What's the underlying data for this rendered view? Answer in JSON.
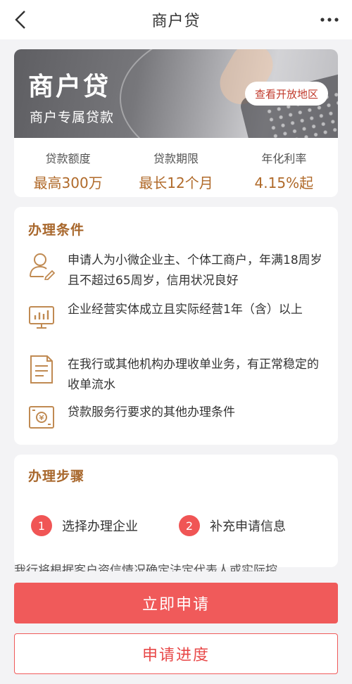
{
  "navbar": {
    "title": "商户贷",
    "back_icon": "chevron-left-icon",
    "more_icon": "more-dots-icon"
  },
  "banner": {
    "title": "商户贷",
    "subtitle": "商户专属贷款",
    "region_button": "查看开放地区"
  },
  "stats": [
    {
      "label": "贷款额度",
      "value": "最高300万"
    },
    {
      "label": "贷款期限",
      "value": "最长12个月"
    },
    {
      "label": "年化利率",
      "value": "4.15%起"
    }
  ],
  "conditions": {
    "title": "办理条件",
    "items": [
      {
        "icon": "user-edit-icon",
        "text": "申请人为小微企业主、个体工商户，年满18周岁且不超过65周岁，信用状况良好"
      },
      {
        "icon": "bar-chart-monitor-icon",
        "text": "企业经营实体成立且实际经营1年（含）以上"
      },
      {
        "icon": "document-icon",
        "text": "在我行或其他机构办理收单业务，有正常稳定的收单流水"
      },
      {
        "icon": "money-bill-icon",
        "text": "贷款服务行要求的其他办理条件"
      }
    ]
  },
  "steps": {
    "title": "办理步骤",
    "items": [
      {
        "num": "1",
        "label": "选择办理企业"
      },
      {
        "num": "2",
        "label": "补充申请信息"
      }
    ]
  },
  "cut_text": "我行将根据客户资信情况确定法定代表人或实际控",
  "buttons": {
    "apply": "立即申请",
    "progress": "申请进度"
  },
  "colors": {
    "accent_red": "#f05a5a",
    "gold_text": "#b06a2a"
  }
}
